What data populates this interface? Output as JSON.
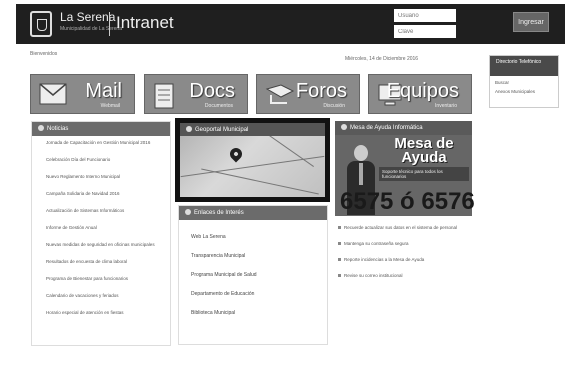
{
  "header": {
    "brand_name": "La Serena",
    "brand_tagline": "Municipalidad de La Serena",
    "app_title": "Intranet",
    "login": {
      "user_placeholder": "Usuario",
      "password_placeholder": "Clave",
      "submit_label": "Ingresar"
    }
  },
  "breadcrumb": {
    "left": "Bienvenidos",
    "right": "Miércoles, 14 de Diciembre 2016"
  },
  "tiles": [
    {
      "label": "Mail",
      "sublabel": "Webmail",
      "icon": "envelope-icon"
    },
    {
      "label": "Docs",
      "sublabel": "Documentos",
      "icon": "document-icon"
    },
    {
      "label": "Foros",
      "sublabel": "Discusión",
      "icon": "forum-icon"
    },
    {
      "label": "Equipos",
      "sublabel": "Inventario",
      "icon": "computer-icon"
    }
  ],
  "noticias": {
    "title": "Noticias",
    "items": [
      "Jornada de Capacitación en Gestión Municipal 2016",
      "Celebración Día del Funcionario",
      "Nuevo Reglamento Interno Municipal",
      "Campaña Solidaria de Navidad 2016",
      "Actualización de Sistemas Informáticos",
      "Informe de Gestión Anual",
      "Nuevas medidas de seguridad en oficinas municipales",
      "Resultados de encuesta de clima laboral",
      "Programa de Bienestar para funcionarios",
      "Calendario de vacaciones y feriados",
      "Horario especial de atención en fiestas"
    ]
  },
  "geo": {
    "title": "Geoportal Municipal"
  },
  "links": {
    "title": "Enlaces de Interés",
    "items": [
      "Web La Serena",
      "Transparencia Municipal",
      "Programa Municipal de Salud",
      "Departamento de Educación",
      "Biblioteca Municipal"
    ]
  },
  "promo": {
    "header": "Mesa de Ayuda Informática",
    "title": "Mesa de Ayuda",
    "subtitle": "Soporte técnico para todos los funcionarios",
    "number": "6575 ó 6576"
  },
  "announcements": [
    "Recuerde actualizar sus datos en el sistema de personal",
    "Mantenga su contraseña segura",
    "Reporte incidencias a la Mesa de Ayuda",
    "Revise su correo institucional"
  ],
  "sidebar": {
    "title": "Directorio Telefónico",
    "items": [
      "Buscar",
      "Anexos Municipales"
    ]
  }
}
